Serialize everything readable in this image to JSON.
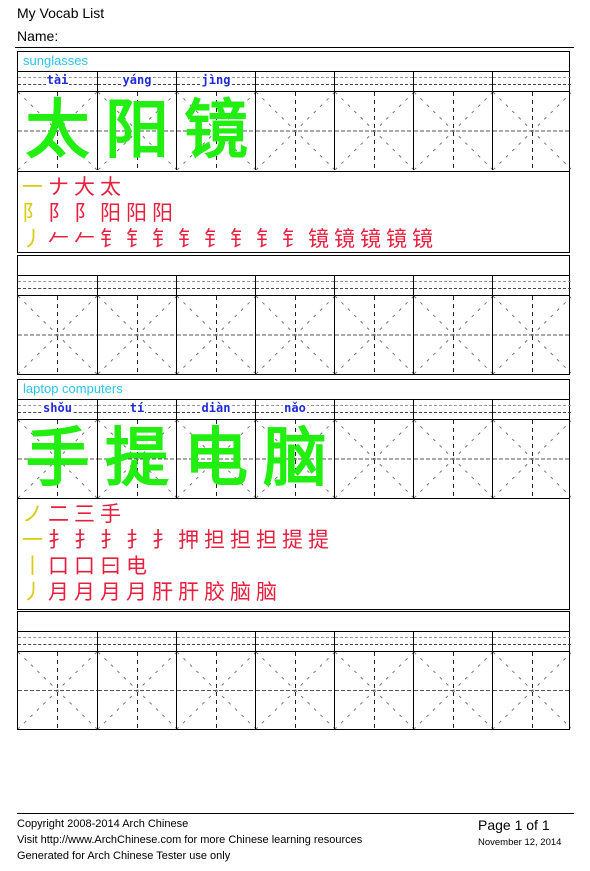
{
  "header": {
    "title": "My Vocab List",
    "name_label": "Name:"
  },
  "colors": {
    "title_text": "#29c5ee",
    "pinyin_text": "#1f2bd9",
    "character": "#22ee11",
    "stroke_current": "#d8cc10",
    "stroke_previous": "#e8203f"
  },
  "words": [
    {
      "meaning": "sunglasses",
      "pinyin": [
        "tài",
        "yáng",
        "jìng"
      ],
      "characters": [
        "太",
        "阳",
        "镜"
      ],
      "stroke_order": [
        [
          "一",
          "ナ",
          "大",
          "太"
        ],
        [
          "阝",
          "阝",
          "阝",
          "阳",
          "阳",
          "阳"
        ],
        [
          "丿",
          "𠂉",
          "𠂉",
          "钅",
          "钅",
          "钅",
          "钅",
          "钅",
          "钅",
          "钅",
          "钅",
          "镜",
          "镜",
          "镜",
          "镜",
          "镜"
        ]
      ]
    },
    {
      "meaning": "laptop computers",
      "pinyin": [
        "shǒu",
        "tí",
        "diàn",
        "nǎo"
      ],
      "characters": [
        "手",
        "提",
        "电",
        "脑"
      ],
      "stroke_order": [
        [
          "ノ",
          "二",
          "三",
          "手"
        ],
        [
          "一",
          "扌",
          "扌",
          "扌",
          "扌",
          "扌",
          "押",
          "担",
          "担",
          "担",
          "提",
          "提"
        ],
        [
          "丨",
          "口",
          "口",
          "曰",
          "电"
        ],
        [
          "丿",
          "月",
          "月",
          "月",
          "月",
          "肝",
          "肝",
          "胶",
          "脑",
          "脑"
        ]
      ]
    }
  ],
  "footer": {
    "copyright": "Copyright 2008-2014 Arch Chinese",
    "visit": "Visit http://www.ArchChinese.com for more Chinese learning resources",
    "generated": "Generated for Arch Chinese Tester use only",
    "page": "Page 1 of 1",
    "date": "November 12, 2014"
  }
}
